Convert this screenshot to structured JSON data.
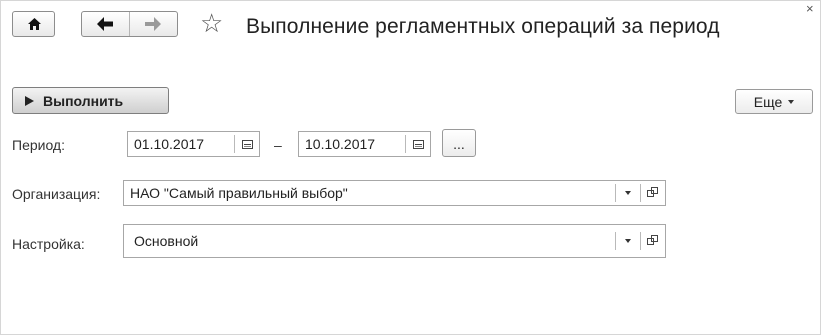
{
  "window": {
    "title": "Выполнение регламентных операций за период",
    "close_glyph": "×"
  },
  "nav": {
    "home_icon": "home-icon",
    "back_icon": "arrow-left-icon",
    "forward_icon": "arrow-right-icon",
    "favorite_icon": "star-icon",
    "favorite_glyph": "☆"
  },
  "toolbar": {
    "run_label": "Выполнить",
    "more_label": "Еще"
  },
  "form": {
    "period": {
      "label": "Период:",
      "from": "01.10.2017",
      "separator": "–",
      "to": "10.10.2017",
      "choose_label": "..."
    },
    "organization": {
      "label": "Организация:",
      "value": "НАО \"Самый правильный выбор\""
    },
    "setting": {
      "label": "Настройка:",
      "value": "Основной"
    }
  },
  "colors": {
    "border": "#a7a7a7",
    "button_gradient_top": "#f3f3f3",
    "button_gradient_bottom": "#cfcfcf",
    "text": "#222222"
  }
}
